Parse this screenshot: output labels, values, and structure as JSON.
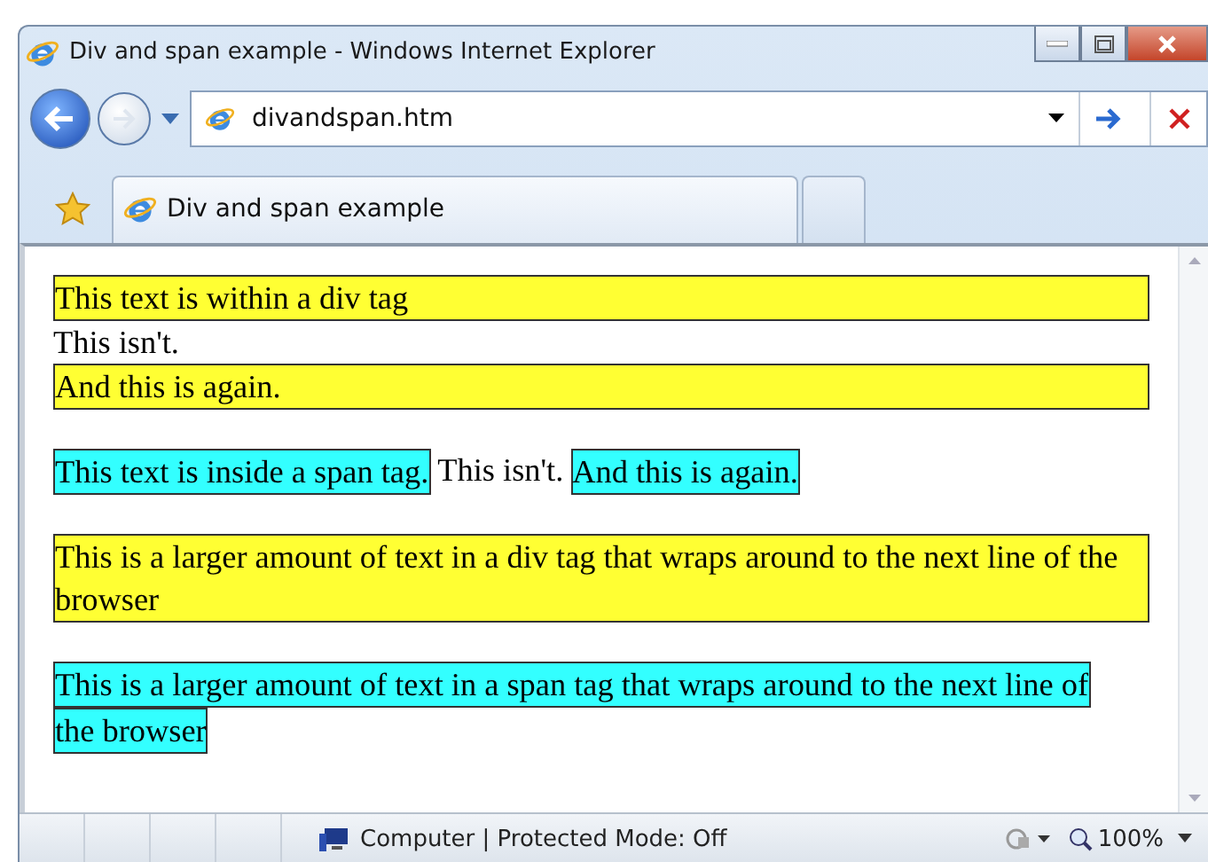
{
  "window": {
    "title": "Div and span example - Windows Internet Explorer"
  },
  "address_bar": {
    "value": "divandspan.htm"
  },
  "tabs": [
    {
      "label": "Div and span example",
      "selected": true
    },
    {
      "selected": false
    }
  ],
  "content": [
    {
      "kind": "div",
      "text": "This text is within a div tag"
    },
    {
      "kind": "text",
      "text": "This isn't."
    },
    {
      "kind": "div",
      "text": "And this is again."
    },
    {
      "kind": "line",
      "items": [
        {
          "kind": "span",
          "text": "This text is inside a span tag."
        },
        {
          "kind": "text",
          "text": "This isn't."
        },
        {
          "kind": "span",
          "text": "And this is again."
        }
      ]
    },
    {
      "kind": "div",
      "text": "This is a larger amount of text in a div tag that wraps around to the next line of the browser"
    },
    {
      "kind": "line",
      "items": [
        {
          "kind": "span",
          "text": "This is a larger amount of text in a span tag that wraps around to the next line of"
        },
        {
          "kind": "span",
          "text": "the browser"
        }
      ]
    }
  ],
  "status_bar": {
    "zone": "Computer | Protected Mode: Off",
    "zoom": "100%"
  }
}
